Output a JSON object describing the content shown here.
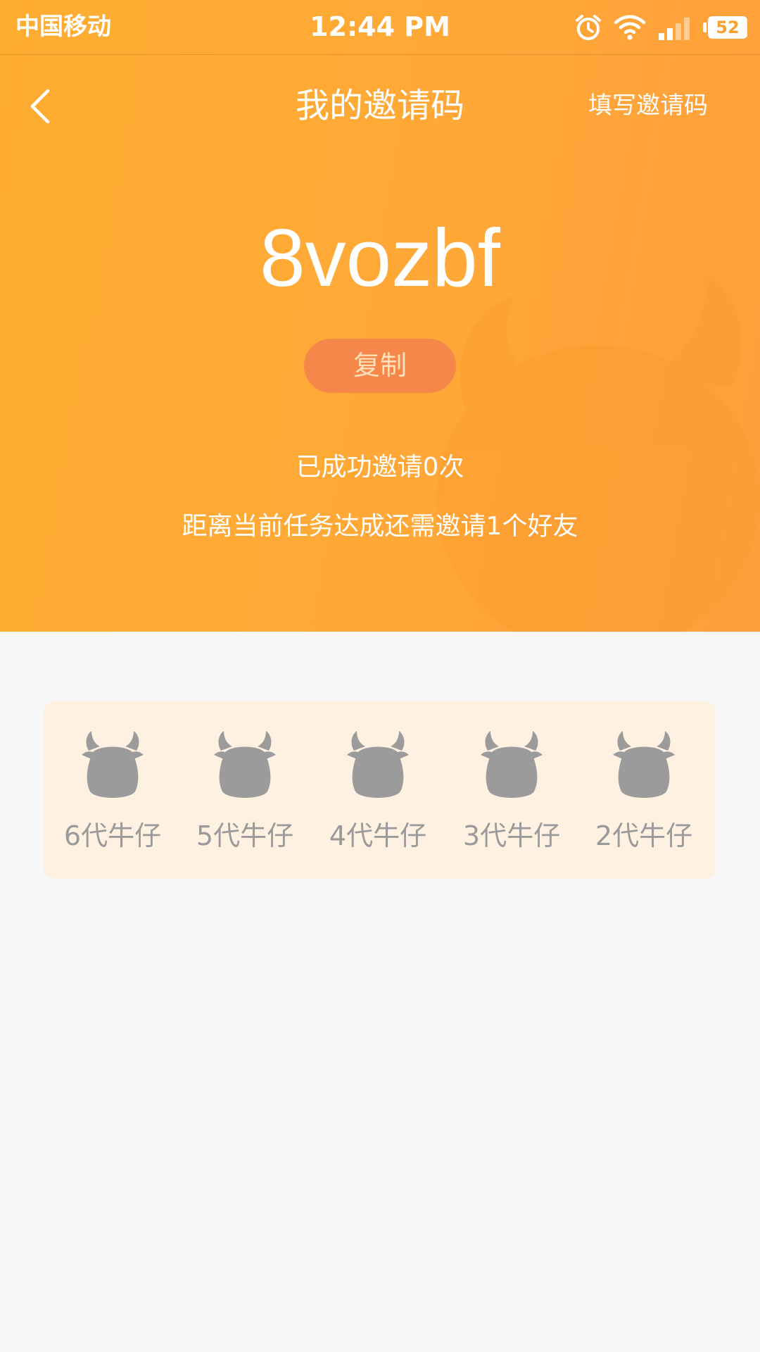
{
  "status_bar": {
    "carrier": "中国移动",
    "time": "12:44 PM",
    "battery": "52",
    "icons": [
      "alarm-icon",
      "wifi-icon",
      "signal-icon",
      "battery-icon"
    ]
  },
  "nav": {
    "back_icon": "chevron-left-icon",
    "title": "我的邀请码",
    "action_label": "填写邀请码"
  },
  "invite": {
    "code": "8vozbf",
    "copy_label": "复制",
    "success_text": "已成功邀请0次",
    "remaining_text": "距离当前任务达成还需邀请1个好友"
  },
  "generations": {
    "items": [
      {
        "label": "6代牛仔",
        "icon": "cow-icon"
      },
      {
        "label": "5代牛仔",
        "icon": "cow-icon"
      },
      {
        "label": "4代牛仔",
        "icon": "cow-icon"
      },
      {
        "label": "3代牛仔",
        "icon": "cow-icon"
      },
      {
        "label": "2代牛仔",
        "icon": "cow-icon"
      }
    ]
  },
  "colors": {
    "header_orange": "#ffab32",
    "copy_button": "#f5874a",
    "card_background": "#fff1e2",
    "cow_gray": "#9b9b9b",
    "page_background": "#f7f7f7"
  }
}
